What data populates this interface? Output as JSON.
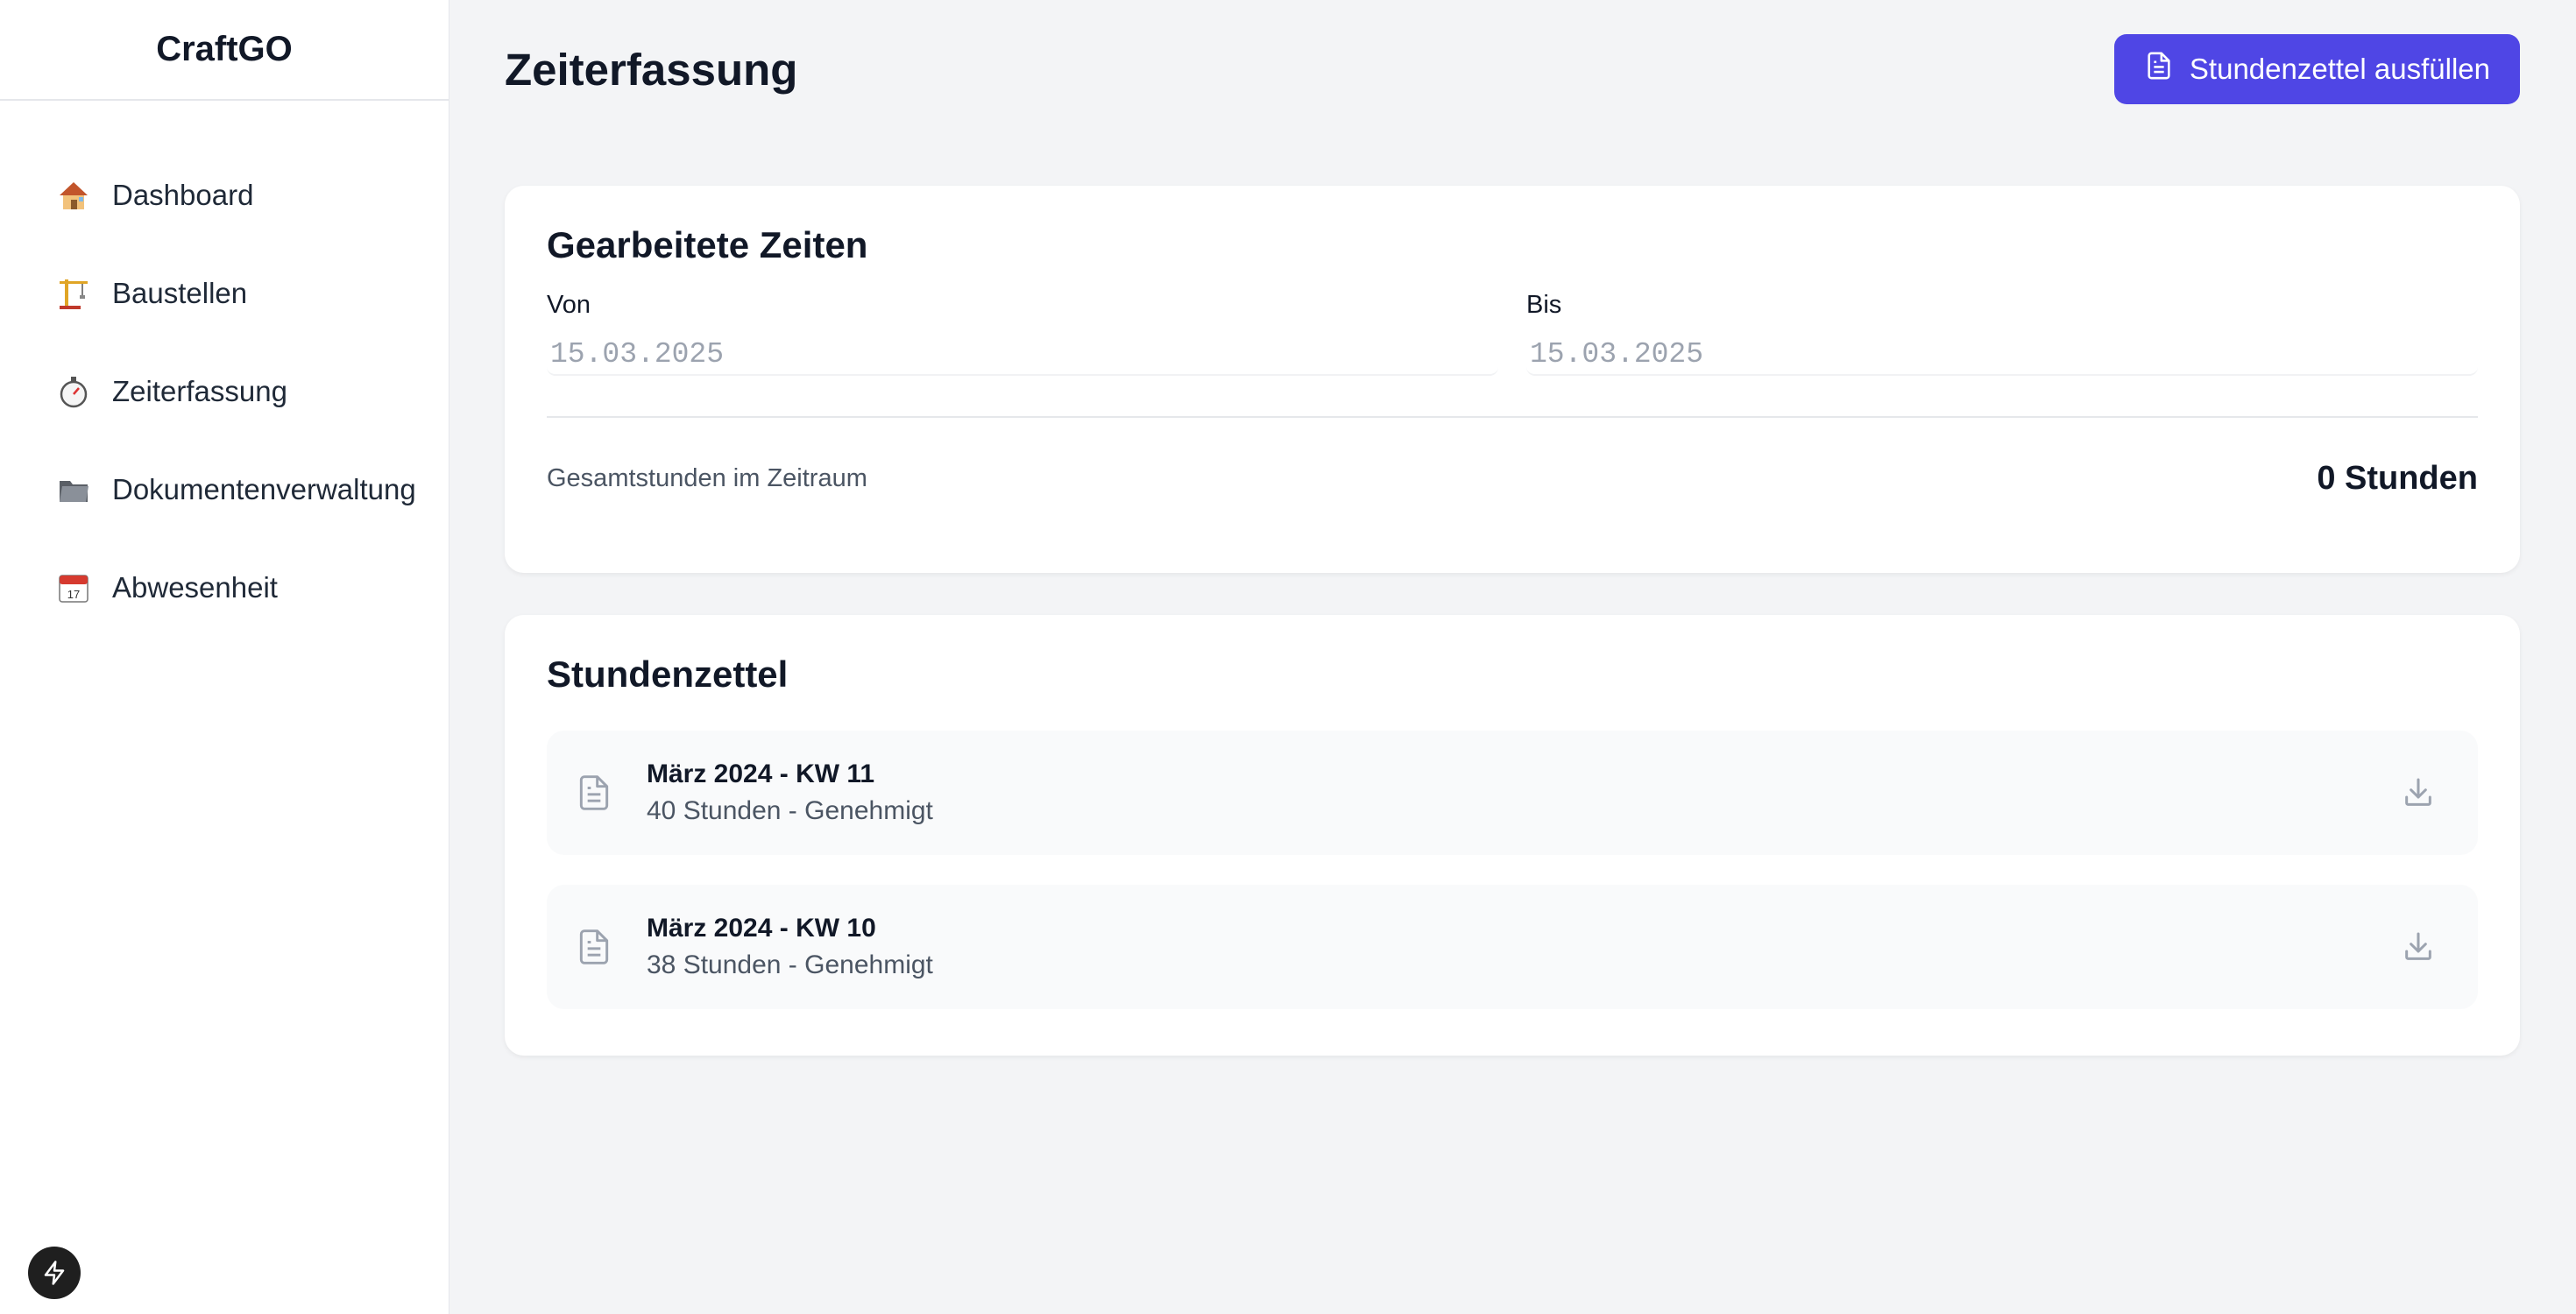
{
  "app": {
    "brand": "CraftGO"
  },
  "sidebar": {
    "items": [
      {
        "label": "Dashboard",
        "emoji": "🏠",
        "icon": "house-icon"
      },
      {
        "label": "Baustellen",
        "emoji": "🏗️",
        "icon": "construction-crane-icon"
      },
      {
        "label": "Zeiterfassung",
        "emoji": "⏱️",
        "icon": "stopwatch-icon"
      },
      {
        "label": "Dokumentenverwaltung",
        "emoji": "📁",
        "icon": "folder-icon"
      },
      {
        "label": "Abwesenheit",
        "emoji": "📅",
        "icon": "calendar-icon"
      }
    ]
  },
  "header": {
    "title": "Zeiterfassung",
    "primary_button": "Stundenzettel ausfüllen"
  },
  "worked_times": {
    "title": "Gearbeitete Zeiten",
    "from_label": "Von",
    "from_value": "15.03.2025",
    "to_label": "Bis",
    "to_value": "15.03.2025",
    "total_label": "Gesamtstunden im Zeitraum",
    "total_value": "0 Stunden"
  },
  "timesheets": {
    "title": "Stundenzettel",
    "items": [
      {
        "title": "März 2024 - KW 11",
        "subtitle": "40 Stunden - Genehmigt"
      },
      {
        "title": "März 2024 - KW 10",
        "subtitle": "38 Stunden - Genehmigt"
      }
    ]
  },
  "colors": {
    "accent": "#4f46e5",
    "background": "#f3f4f6",
    "card": "#ffffff"
  }
}
